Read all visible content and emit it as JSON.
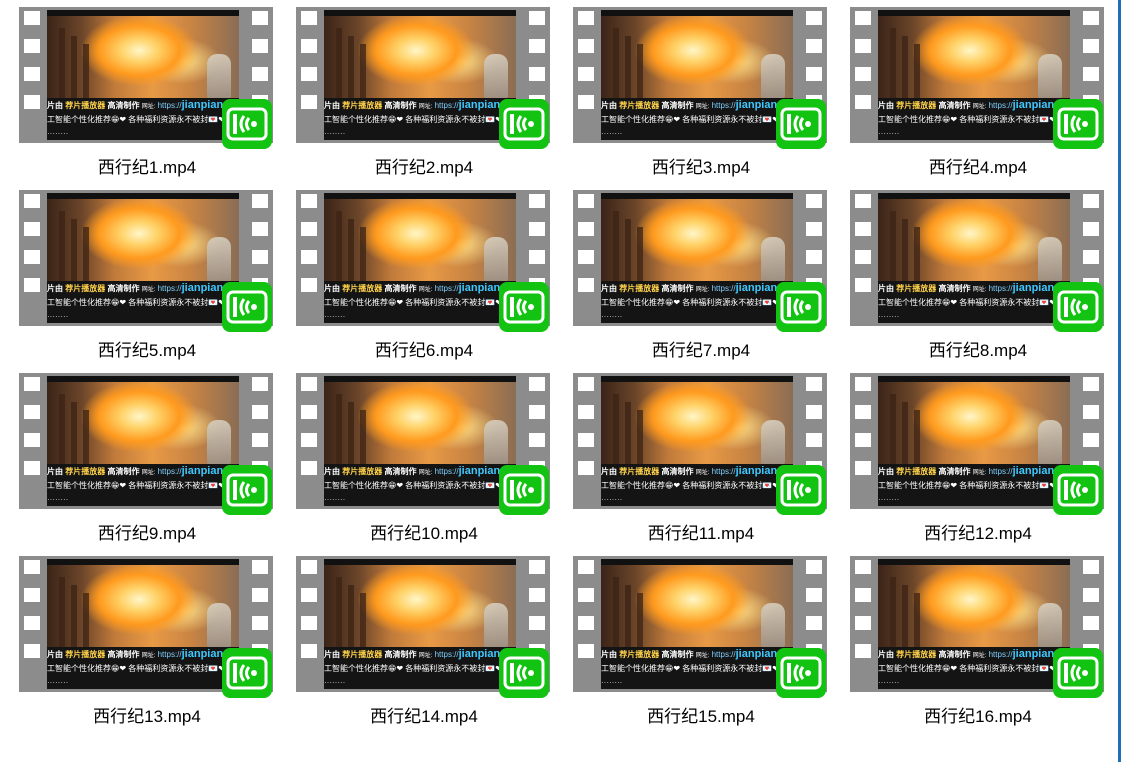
{
  "files": [
    {
      "name": "西行纪1.mp4"
    },
    {
      "name": "西行纪2.mp4"
    },
    {
      "name": "西行纪3.mp4"
    },
    {
      "name": "西行纪4.mp4"
    },
    {
      "name": "西行纪5.mp4"
    },
    {
      "name": "西行纪6.mp4"
    },
    {
      "name": "西行纪7.mp4"
    },
    {
      "name": "西行纪8.mp4"
    },
    {
      "name": "西行纪9.mp4"
    },
    {
      "name": "西行纪10.mp4"
    },
    {
      "name": "西行纪11.mp4"
    },
    {
      "name": "西行纪12.mp4"
    },
    {
      "name": "西行纪13.mp4"
    },
    {
      "name": "西行纪14.mp4"
    },
    {
      "name": "西行纪15.mp4"
    },
    {
      "name": "西行纪16.mp4"
    }
  ],
  "thumbnail_caption": {
    "line1_a": "片由",
    "line1_b": "荐片播放器",
    "line1_c": "高清制作",
    "line1_site": "网址:",
    "line1_url": "https://",
    "line1_brand": "jianpian",
    "line2": "工智能个性化推荐😁❤ 各种福利资源永不被封💌❤",
    "line3": "········"
  },
  "colors": {
    "film": "#8c8c8c",
    "badge": "#12c312",
    "scroll_edge": "#1f6fb8"
  },
  "icons": {
    "file_type_badge": "video-player-badge-icon"
  }
}
